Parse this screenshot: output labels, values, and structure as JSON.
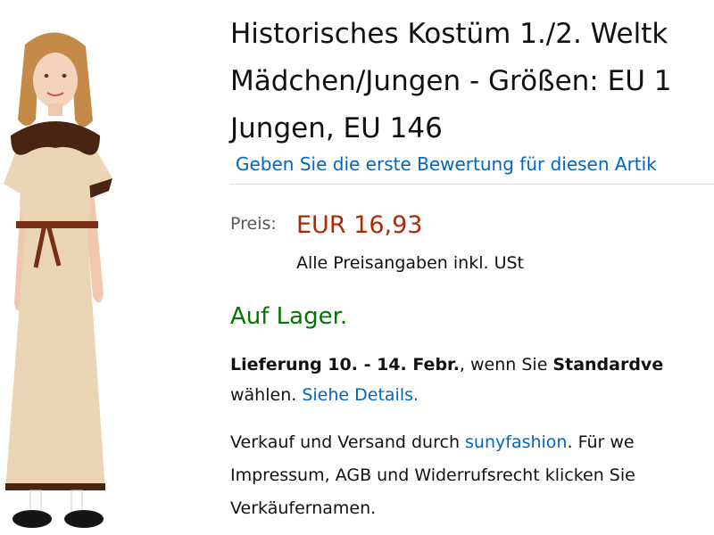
{
  "product": {
    "image_alt": "Mädchen im historischen Kleid mit Kragen und Gürtel",
    "title_lines": [
      "Historisches Kostüm 1./2. Weltk",
      "Mädchen/Jungen - Größen: EU 1",
      "Jungen, EU 146"
    ],
    "review_link": "Geben Sie die erste Bewertung für diesen Artik"
  },
  "price": {
    "label": "Preis:",
    "value": "EUR 16,93",
    "note": "Alle Preisangaben inkl. USt"
  },
  "stock": {
    "status": "Auf Lager."
  },
  "delivery": {
    "line1_bold_a": "Lieferung 10. - 14. Febr.",
    "line1_text": ", wenn Sie ",
    "line1_bold_b": "Standardve",
    "line2_text": "wählen. ",
    "details_link": "Siehe Details."
  },
  "seller": {
    "line1_text": "Verkauf und Versand durch ",
    "seller_link": "sunyfashion",
    "line1_after": ". Für we",
    "line2_text": "Impressum, AGB und Widerrufsrecht klicken Sie",
    "line3_text": "Verkäufernamen."
  },
  "colors": {
    "link": "#0066c0",
    "price": "#b12704",
    "stock": "#007600"
  }
}
